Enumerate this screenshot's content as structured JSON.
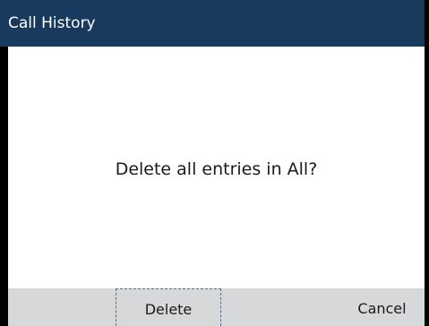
{
  "header": {
    "title": "Call History"
  },
  "dialog": {
    "message": "Delete all entries in All?"
  },
  "softkeys": {
    "delete_label": "Delete",
    "cancel_label": "Cancel"
  },
  "colors": {
    "titlebar": "#173a5e",
    "softkey_bar": "#d7d8da",
    "content_bg": "#ffffff",
    "focus_border": "#5a6e85"
  }
}
